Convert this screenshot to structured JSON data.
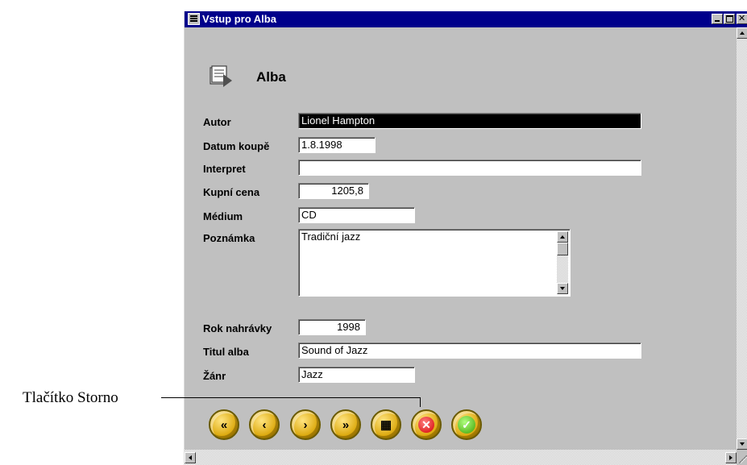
{
  "window": {
    "title": "Vstup pro Alba",
    "heading": "Alba",
    "title_icon": "form-icon",
    "controls": [
      "minimize",
      "maximize",
      "close"
    ],
    "colors": {
      "titlebar": "#00008b",
      "face": "#c0c0c0",
      "selection": "#000000"
    }
  },
  "fields": [
    {
      "label": "Autor",
      "value": "Lionel Hampton",
      "selected": true
    },
    {
      "label": "Datum koupě",
      "value": "1.8.1998"
    },
    {
      "label": "Interpret",
      "value": ""
    },
    {
      "label": "Kupní cena",
      "value": "1205,8"
    },
    {
      "label": "Médium",
      "value": "CD"
    },
    {
      "label": "Poznámka",
      "value": "Tradiční jazz"
    },
    {
      "label": "Rok nahrávky",
      "value": "1998"
    },
    {
      "label": "Titul alba",
      "value": "Sound of Jazz"
    },
    {
      "label": "Žánr",
      "value": "Jazz"
    }
  ],
  "toolbar": {
    "buttons": [
      {
        "icon": "first-record-icon",
        "glyph": "«"
      },
      {
        "icon": "previous-record-icon",
        "glyph": "‹"
      },
      {
        "icon": "next-record-icon",
        "glyph": "›"
      },
      {
        "icon": "last-record-icon",
        "glyph": "»"
      },
      {
        "icon": "new-record-icon",
        "glyph": "▦"
      },
      {
        "icon": "cancel-icon",
        "glyph": "✕"
      },
      {
        "icon": "confirm-icon",
        "glyph": "✓"
      }
    ]
  },
  "annotation": {
    "callout": "Tlačítko Storno"
  }
}
